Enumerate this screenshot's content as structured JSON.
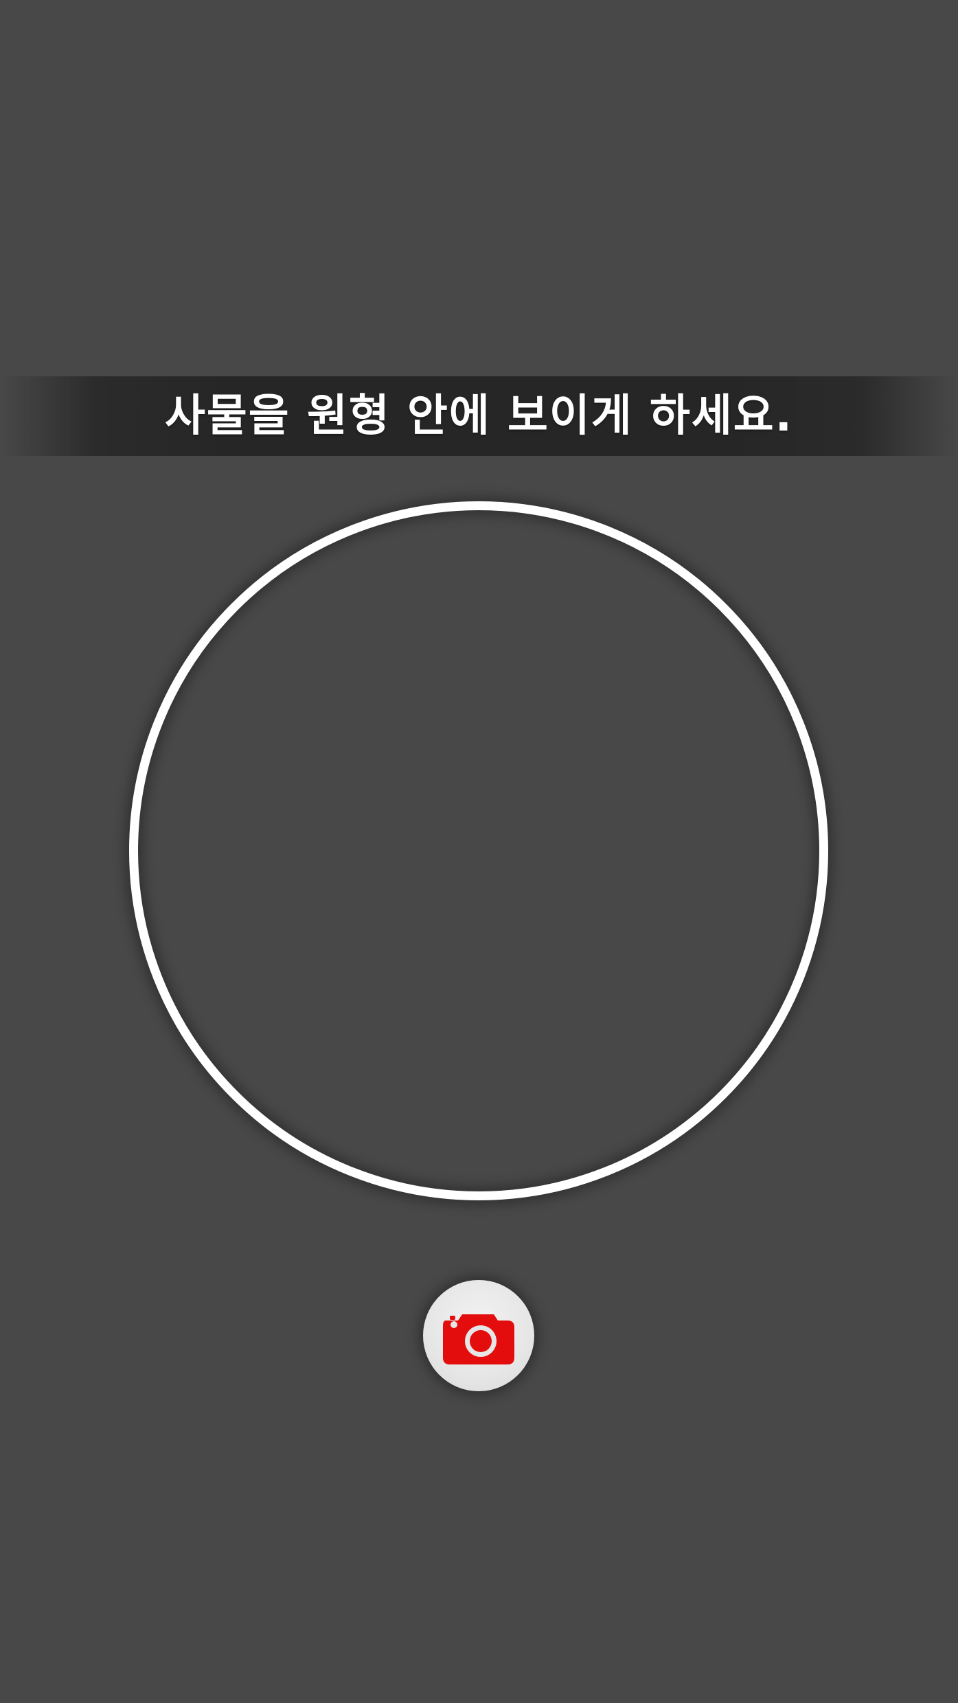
{
  "instruction": {
    "text": "사물을 원형 안에 보이게 하세요."
  },
  "viewfinder": {
    "icon": "viewfinder-circle"
  },
  "capture_button": {
    "icon": "camera-icon",
    "icon_color": "#e30d0d",
    "background_color": "#e6e6e6"
  },
  "colors": {
    "background": "#484848",
    "banner": "#262626",
    "ring": "#ffffff",
    "accent": "#e30d0d"
  }
}
